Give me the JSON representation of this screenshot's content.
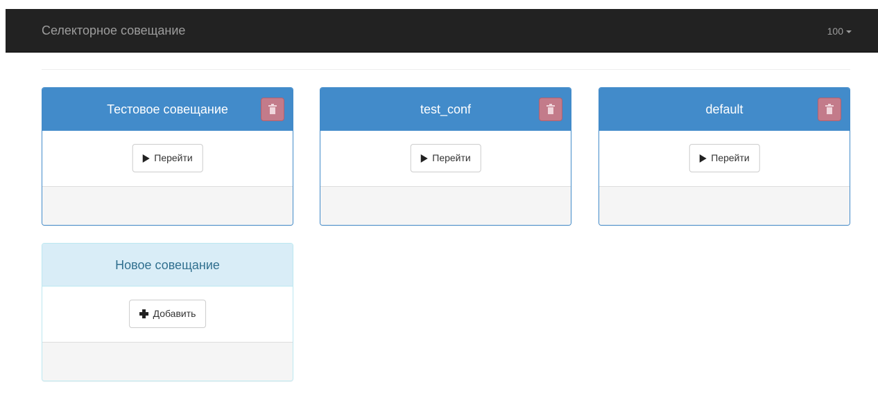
{
  "navbar": {
    "brand": "Селекторное совещание",
    "right_menu_label": "100"
  },
  "conferences": [
    {
      "title": "Тестовое совещание",
      "action_label": "Перейти"
    },
    {
      "title": "test_conf",
      "action_label": "Перейти"
    },
    {
      "title": "default",
      "action_label": "Перейти"
    }
  ],
  "new_conference": {
    "title": "Новое совещание",
    "action_label": "Добавить"
  },
  "colors": {
    "navbar_bg": "#222222",
    "primary": "#428bca",
    "danger_muted": "#c37b8a",
    "info_bg": "#d9edf7",
    "info_text": "#31708f"
  },
  "icons": {
    "play": "play-icon",
    "trash": "trash-icon",
    "plus": "plus-icon",
    "caret": "caret-down-icon"
  }
}
